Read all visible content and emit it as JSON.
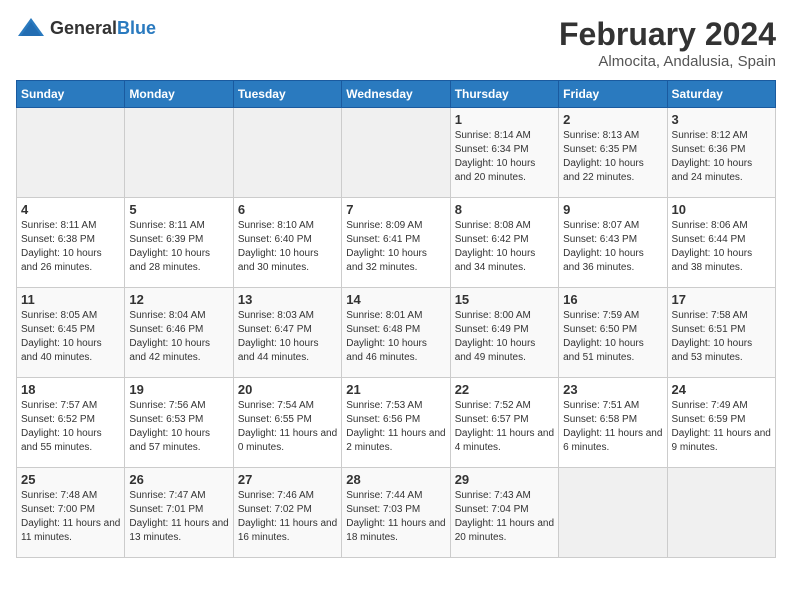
{
  "header": {
    "logo_general": "General",
    "logo_blue": "Blue",
    "title": "February 2024",
    "subtitle": "Almocita, Andalusia, Spain"
  },
  "days_of_week": [
    "Sunday",
    "Monday",
    "Tuesday",
    "Wednesday",
    "Thursday",
    "Friday",
    "Saturday"
  ],
  "weeks": [
    [
      {
        "day": "",
        "info": ""
      },
      {
        "day": "",
        "info": ""
      },
      {
        "day": "",
        "info": ""
      },
      {
        "day": "",
        "info": ""
      },
      {
        "day": "1",
        "info": "Sunrise: 8:14 AM\nSunset: 6:34 PM\nDaylight: 10 hours and 20 minutes."
      },
      {
        "day": "2",
        "info": "Sunrise: 8:13 AM\nSunset: 6:35 PM\nDaylight: 10 hours and 22 minutes."
      },
      {
        "day": "3",
        "info": "Sunrise: 8:12 AM\nSunset: 6:36 PM\nDaylight: 10 hours and 24 minutes."
      }
    ],
    [
      {
        "day": "4",
        "info": "Sunrise: 8:11 AM\nSunset: 6:38 PM\nDaylight: 10 hours and 26 minutes."
      },
      {
        "day": "5",
        "info": "Sunrise: 8:11 AM\nSunset: 6:39 PM\nDaylight: 10 hours and 28 minutes."
      },
      {
        "day": "6",
        "info": "Sunrise: 8:10 AM\nSunset: 6:40 PM\nDaylight: 10 hours and 30 minutes."
      },
      {
        "day": "7",
        "info": "Sunrise: 8:09 AM\nSunset: 6:41 PM\nDaylight: 10 hours and 32 minutes."
      },
      {
        "day": "8",
        "info": "Sunrise: 8:08 AM\nSunset: 6:42 PM\nDaylight: 10 hours and 34 minutes."
      },
      {
        "day": "9",
        "info": "Sunrise: 8:07 AM\nSunset: 6:43 PM\nDaylight: 10 hours and 36 minutes."
      },
      {
        "day": "10",
        "info": "Sunrise: 8:06 AM\nSunset: 6:44 PM\nDaylight: 10 hours and 38 minutes."
      }
    ],
    [
      {
        "day": "11",
        "info": "Sunrise: 8:05 AM\nSunset: 6:45 PM\nDaylight: 10 hours and 40 minutes."
      },
      {
        "day": "12",
        "info": "Sunrise: 8:04 AM\nSunset: 6:46 PM\nDaylight: 10 hours and 42 minutes."
      },
      {
        "day": "13",
        "info": "Sunrise: 8:03 AM\nSunset: 6:47 PM\nDaylight: 10 hours and 44 minutes."
      },
      {
        "day": "14",
        "info": "Sunrise: 8:01 AM\nSunset: 6:48 PM\nDaylight: 10 hours and 46 minutes."
      },
      {
        "day": "15",
        "info": "Sunrise: 8:00 AM\nSunset: 6:49 PM\nDaylight: 10 hours and 49 minutes."
      },
      {
        "day": "16",
        "info": "Sunrise: 7:59 AM\nSunset: 6:50 PM\nDaylight: 10 hours and 51 minutes."
      },
      {
        "day": "17",
        "info": "Sunrise: 7:58 AM\nSunset: 6:51 PM\nDaylight: 10 hours and 53 minutes."
      }
    ],
    [
      {
        "day": "18",
        "info": "Sunrise: 7:57 AM\nSunset: 6:52 PM\nDaylight: 10 hours and 55 minutes."
      },
      {
        "day": "19",
        "info": "Sunrise: 7:56 AM\nSunset: 6:53 PM\nDaylight: 10 hours and 57 minutes."
      },
      {
        "day": "20",
        "info": "Sunrise: 7:54 AM\nSunset: 6:55 PM\nDaylight: 11 hours and 0 minutes."
      },
      {
        "day": "21",
        "info": "Sunrise: 7:53 AM\nSunset: 6:56 PM\nDaylight: 11 hours and 2 minutes."
      },
      {
        "day": "22",
        "info": "Sunrise: 7:52 AM\nSunset: 6:57 PM\nDaylight: 11 hours and 4 minutes."
      },
      {
        "day": "23",
        "info": "Sunrise: 7:51 AM\nSunset: 6:58 PM\nDaylight: 11 hours and 6 minutes."
      },
      {
        "day": "24",
        "info": "Sunrise: 7:49 AM\nSunset: 6:59 PM\nDaylight: 11 hours and 9 minutes."
      }
    ],
    [
      {
        "day": "25",
        "info": "Sunrise: 7:48 AM\nSunset: 7:00 PM\nDaylight: 11 hours and 11 minutes."
      },
      {
        "day": "26",
        "info": "Sunrise: 7:47 AM\nSunset: 7:01 PM\nDaylight: 11 hours and 13 minutes."
      },
      {
        "day": "27",
        "info": "Sunrise: 7:46 AM\nSunset: 7:02 PM\nDaylight: 11 hours and 16 minutes."
      },
      {
        "day": "28",
        "info": "Sunrise: 7:44 AM\nSunset: 7:03 PM\nDaylight: 11 hours and 18 minutes."
      },
      {
        "day": "29",
        "info": "Sunrise: 7:43 AM\nSunset: 7:04 PM\nDaylight: 11 hours and 20 minutes."
      },
      {
        "day": "",
        "info": ""
      },
      {
        "day": "",
        "info": ""
      }
    ]
  ]
}
